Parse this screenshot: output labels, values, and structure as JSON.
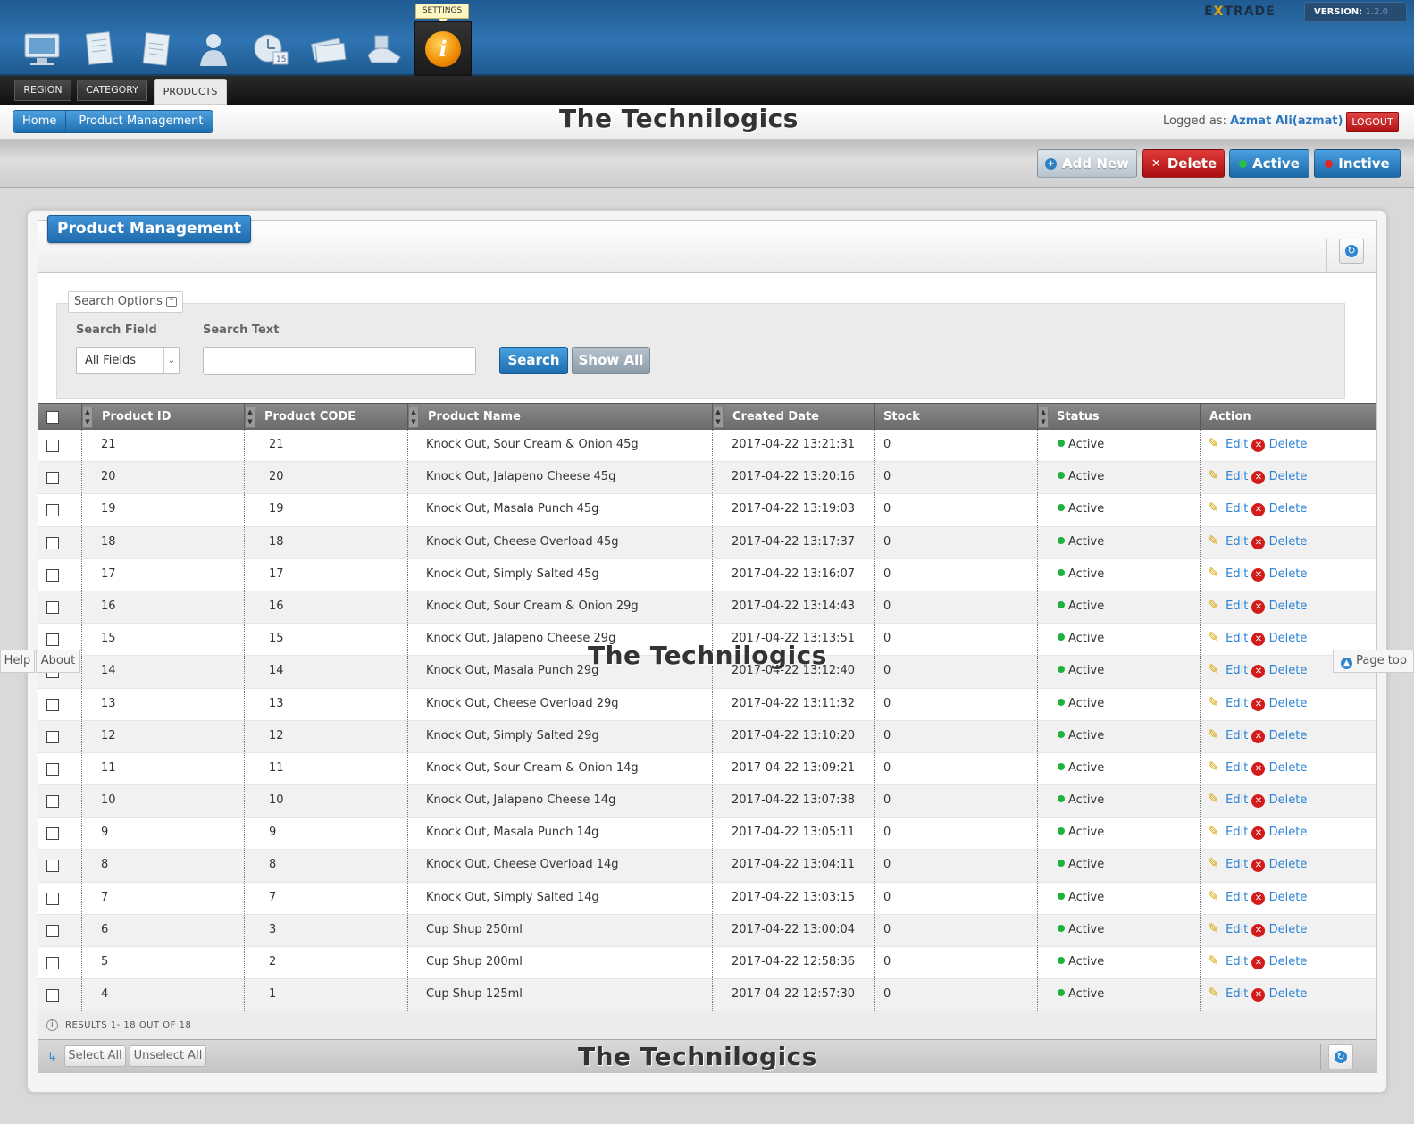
{
  "header": {
    "settings_tooltip": "SETTINGS",
    "brand_pre": "E",
    "brand_x": "X",
    "brand_post": "TRADE",
    "version_label": "VERSION:",
    "version_value": "1.2.0",
    "app_icons": [
      "monitor-icon",
      "document-icon",
      "notepad-icon",
      "user-icon",
      "calendar-icon",
      "money-icon",
      "delivery-icon",
      "info-icon"
    ]
  },
  "tabs": [
    "REGION",
    "CATEGORY",
    "PRODUCTS"
  ],
  "active_tab": "PRODUCTS",
  "breadcrumb": [
    "Home",
    "Product Management"
  ],
  "watermark": "The Technilogics",
  "logged_as_label": "Logged as:",
  "logged_user": "Azmat Ali(azmat)",
  "logout_label": "LOGOUT",
  "toolbar": {
    "add_new": "Add New",
    "delete": "Delete",
    "active": "Active",
    "inactive": "Inctive"
  },
  "panel_title": "Product Management",
  "search": {
    "legend": "Search Options",
    "field_label": "Search Field",
    "text_label": "Search Text",
    "field_value": "All Fields",
    "text_value": "",
    "search_button": "Search",
    "show_all_button": "Show All"
  },
  "columns": [
    "Product ID",
    "Product CODE",
    "Product Name",
    "Created Date",
    "Stock",
    "Status",
    "Action"
  ],
  "rows": [
    {
      "id": "21",
      "code": "21",
      "name": "Knock Out, Sour Cream & Onion 45g",
      "created": "2017-04-22 13:21:31",
      "stock": "0",
      "status": "Active"
    },
    {
      "id": "20",
      "code": "20",
      "name": "Knock Out, Jalapeno Cheese 45g",
      "created": "2017-04-22 13:20:16",
      "stock": "0",
      "status": "Active"
    },
    {
      "id": "19",
      "code": "19",
      "name": "Knock Out, Masala Punch 45g",
      "created": "2017-04-22 13:19:03",
      "stock": "0",
      "status": "Active"
    },
    {
      "id": "18",
      "code": "18",
      "name": "Knock Out, Cheese Overload 45g",
      "created": "2017-04-22 13:17:37",
      "stock": "0",
      "status": "Active"
    },
    {
      "id": "17",
      "code": "17",
      "name": "Knock Out, Simply Salted 45g",
      "created": "2017-04-22 13:16:07",
      "stock": "0",
      "status": "Active"
    },
    {
      "id": "16",
      "code": "16",
      "name": "Knock Out, Sour Cream & Onion 29g",
      "created": "2017-04-22 13:14:43",
      "stock": "0",
      "status": "Active"
    },
    {
      "id": "15",
      "code": "15",
      "name": "Knock Out, Jalapeno Cheese 29g",
      "created": "2017-04-22 13:13:51",
      "stock": "0",
      "status": "Active"
    },
    {
      "id": "14",
      "code": "14",
      "name": "Knock Out, Masala Punch 29g",
      "created": "2017-04-22 13:12:40",
      "stock": "0",
      "status": "Active"
    },
    {
      "id": "13",
      "code": "13",
      "name": "Knock Out, Cheese Overload 29g",
      "created": "2017-04-22 13:11:32",
      "stock": "0",
      "status": "Active"
    },
    {
      "id": "12",
      "code": "12",
      "name": "Knock Out, Simply Salted 29g",
      "created": "2017-04-22 13:10:20",
      "stock": "0",
      "status": "Active"
    },
    {
      "id": "11",
      "code": "11",
      "name": "Knock Out, Sour Cream & Onion 14g",
      "created": "2017-04-22 13:09:21",
      "stock": "0",
      "status": "Active"
    },
    {
      "id": "10",
      "code": "10",
      "name": "Knock Out, Jalapeno Cheese 14g",
      "created": "2017-04-22 13:07:38",
      "stock": "0",
      "status": "Active"
    },
    {
      "id": "9",
      "code": "9",
      "name": "Knock Out, Masala Punch 14g",
      "created": "2017-04-22 13:05:11",
      "stock": "0",
      "status": "Active"
    },
    {
      "id": "8",
      "code": "8",
      "name": "Knock Out, Cheese Overload 14g",
      "created": "2017-04-22 13:04:11",
      "stock": "0",
      "status": "Active"
    },
    {
      "id": "7",
      "code": "7",
      "name": "Knock Out, Simply Salted 14g",
      "created": "2017-04-22 13:03:15",
      "stock": "0",
      "status": "Active"
    },
    {
      "id": "6",
      "code": "3",
      "name": "Cup Shup 250ml",
      "created": "2017-04-22 13:00:04",
      "stock": "0",
      "status": "Active"
    },
    {
      "id": "5",
      "code": "2",
      "name": "Cup Shup 200ml",
      "created": "2017-04-22 12:58:36",
      "stock": "0",
      "status": "Active"
    },
    {
      "id": "4",
      "code": "1",
      "name": "Cup Shup 125ml",
      "created": "2017-04-22 12:57:30",
      "stock": "0",
      "status": "Active"
    }
  ],
  "action_edit": "Edit",
  "action_delete": "Delete",
  "results_text": "RESULTS 1- 18 OUT OF 18",
  "select_all": "Select All",
  "unselect_all": "Unselect All",
  "side": {
    "help": "Help",
    "about": "About",
    "page_top": "Page top"
  },
  "colors": {
    "accent": "#1f6fb0",
    "delete": "#c21818",
    "status_active": "#1db33b",
    "link": "#2c82d4"
  }
}
